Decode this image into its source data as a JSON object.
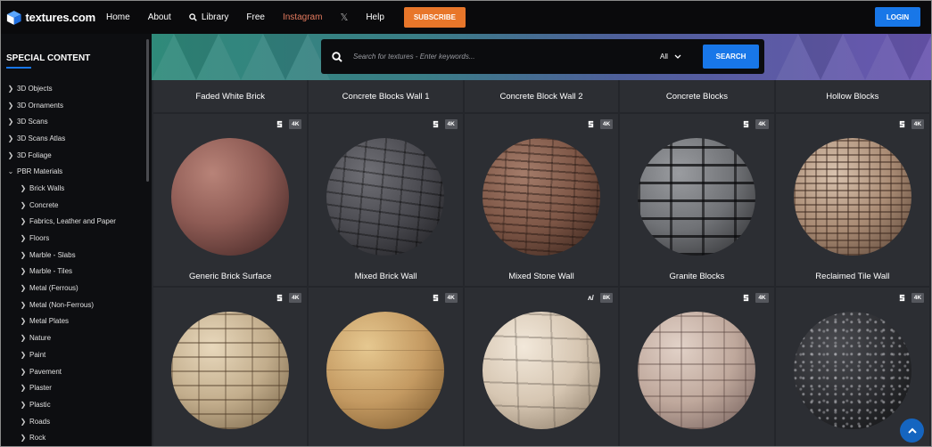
{
  "header": {
    "logo_text": "textures.com",
    "nav": [
      {
        "label": "Home"
      },
      {
        "label": "About"
      },
      {
        "label": "Library"
      },
      {
        "label": "Free"
      },
      {
        "label": "Instagram"
      },
      {
        "label": "Help"
      }
    ],
    "x_glyph": "𝕏",
    "subscribe_label": "SUBSCRIBE",
    "login_label": "LOGIN",
    "accent_color": "#1877e8",
    "subscribe_color": "#e8762a"
  },
  "sidebar": {
    "title": "SPECIAL CONTENT",
    "items": [
      {
        "label": "3D Objects"
      },
      {
        "label": "3D Ornaments"
      },
      {
        "label": "3D Scans"
      },
      {
        "label": "3D Scans Atlas"
      },
      {
        "label": "3D Foliage"
      },
      {
        "label": "PBR Materials"
      },
      {
        "label": "Brick Walls"
      },
      {
        "label": "Concrete"
      },
      {
        "label": "Fabrics, Leather and Paper"
      },
      {
        "label": "Floors"
      },
      {
        "label": "Marble - Slabs"
      },
      {
        "label": "Marble - Tiles"
      },
      {
        "label": "Metal (Ferrous)"
      },
      {
        "label": "Metal (Non-Ferrous)"
      },
      {
        "label": "Metal Plates"
      },
      {
        "label": "Nature"
      },
      {
        "label": "Paint"
      },
      {
        "label": "Pavement"
      },
      {
        "label": "Plaster"
      },
      {
        "label": "Plastic"
      },
      {
        "label": "Roads"
      },
      {
        "label": "Rock"
      }
    ]
  },
  "search": {
    "placeholder": "Search for textures - Enter keywords...",
    "scope": "All",
    "button_label": "SEARCH"
  },
  "grid": {
    "top_row": [
      {
        "label": "Faded White Brick"
      },
      {
        "label": "Concrete Blocks Wall 1"
      },
      {
        "label": "Concrete Block Wall 2"
      },
      {
        "label": "Concrete Blocks"
      },
      {
        "label": "Hollow Blocks"
      }
    ],
    "row2": [
      {
        "label": "Generic Brick Surface",
        "res": "4K",
        "source": "substance"
      },
      {
        "label": "Mixed Brick Wall",
        "res": "4K",
        "source": "substance"
      },
      {
        "label": "Mixed Stone Wall",
        "res": "4K",
        "source": "substance"
      },
      {
        "label": "Granite Blocks",
        "res": "4K",
        "source": "substance"
      },
      {
        "label": "Reclaimed Tile Wall",
        "res": "4K",
        "source": "substance"
      }
    ],
    "row3": [
      {
        "res": "4K",
        "source": "substance"
      },
      {
        "res": "4K",
        "source": "substance"
      },
      {
        "res": "8K",
        "source": "scan"
      },
      {
        "res": "4K",
        "source": "substance"
      },
      {
        "res": "4K",
        "source": "substance"
      }
    ]
  }
}
